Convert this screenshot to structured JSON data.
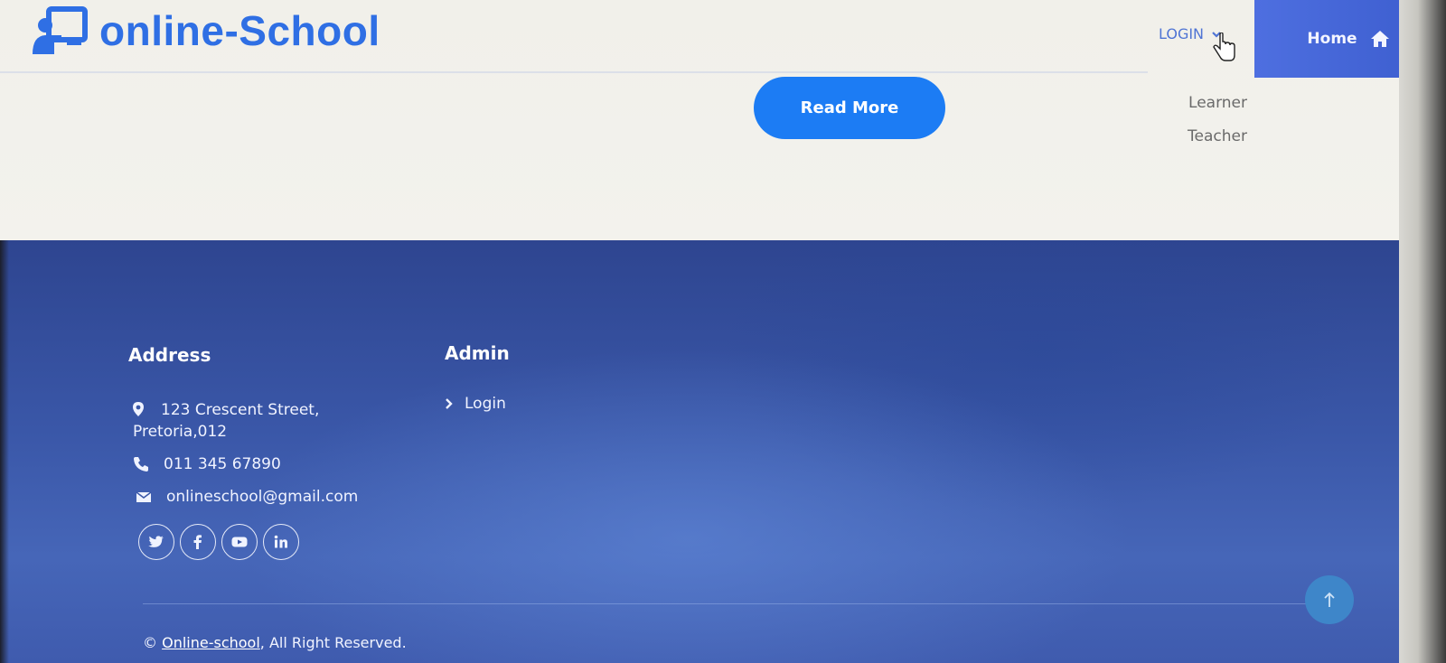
{
  "header": {
    "brand": "online-School",
    "brand_icon": "teacher-board-icon",
    "login_label": "LOGIN",
    "login_dropdown": [
      "Learner",
      "Teacher"
    ],
    "home_label": "Home",
    "home_icon": "home-icon"
  },
  "hero": {
    "read_more_label": "Read More"
  },
  "footer": {
    "address_title": "Address",
    "address_line1": "123 Crescent Street,",
    "address_line2": "Pretoria,012",
    "phone": "011 345 67890",
    "email": "onlineschool@gmail.com",
    "social": [
      "twitter-icon",
      "facebook-icon",
      "youtube-icon",
      "linkedin-icon"
    ],
    "admin_title": "Admin",
    "admin_links": [
      "Login"
    ],
    "copyright_symbol": "©",
    "copyright_link": "Online-school",
    "copyright_text": ", All Right Reserved."
  },
  "colors": {
    "brand_blue": "#2f6fe4",
    "read_more_blue": "#1c7cf4",
    "footer_blue": "#3a57a8",
    "home_button": "#4e6fe0"
  }
}
